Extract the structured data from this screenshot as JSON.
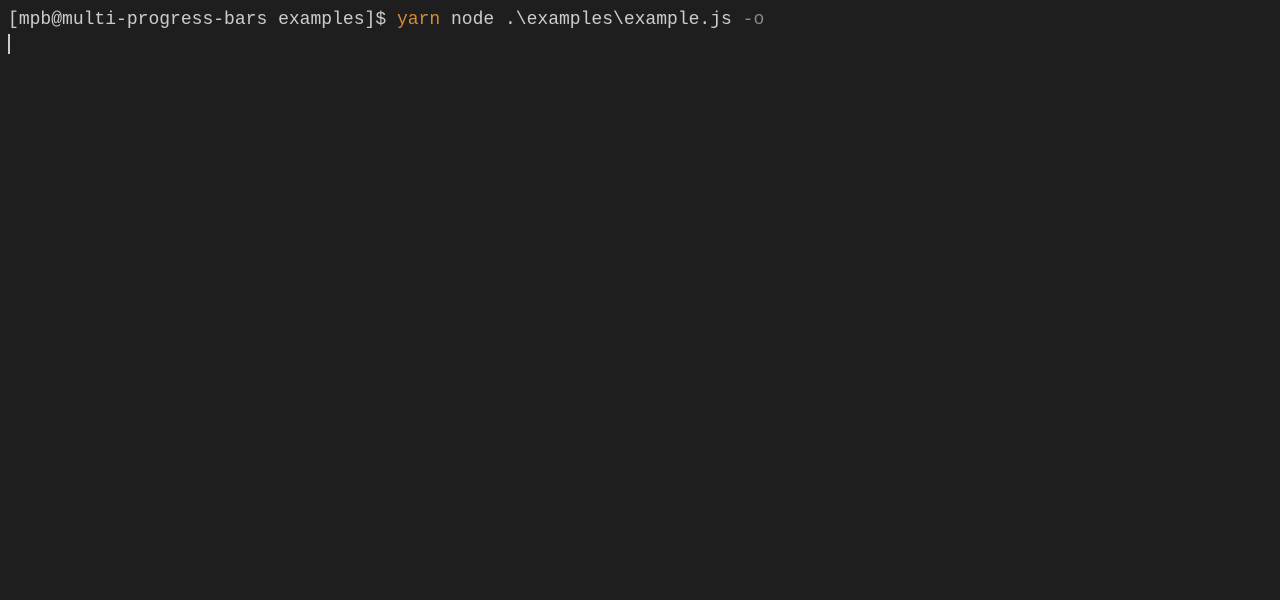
{
  "terminal": {
    "prompt": {
      "open_bracket": "[",
      "user": "mpb",
      "at": "@",
      "host": "multi-progress-bars",
      "space1": " ",
      "path": "examples",
      "close_bracket": "]",
      "symbol": "$",
      "space2": " "
    },
    "command": {
      "yarn": "yarn",
      "space1": " ",
      "node": "node",
      "space2": " ",
      "filepath": ".\\examples\\example.js",
      "space3": " ",
      "flag": "-o"
    }
  }
}
